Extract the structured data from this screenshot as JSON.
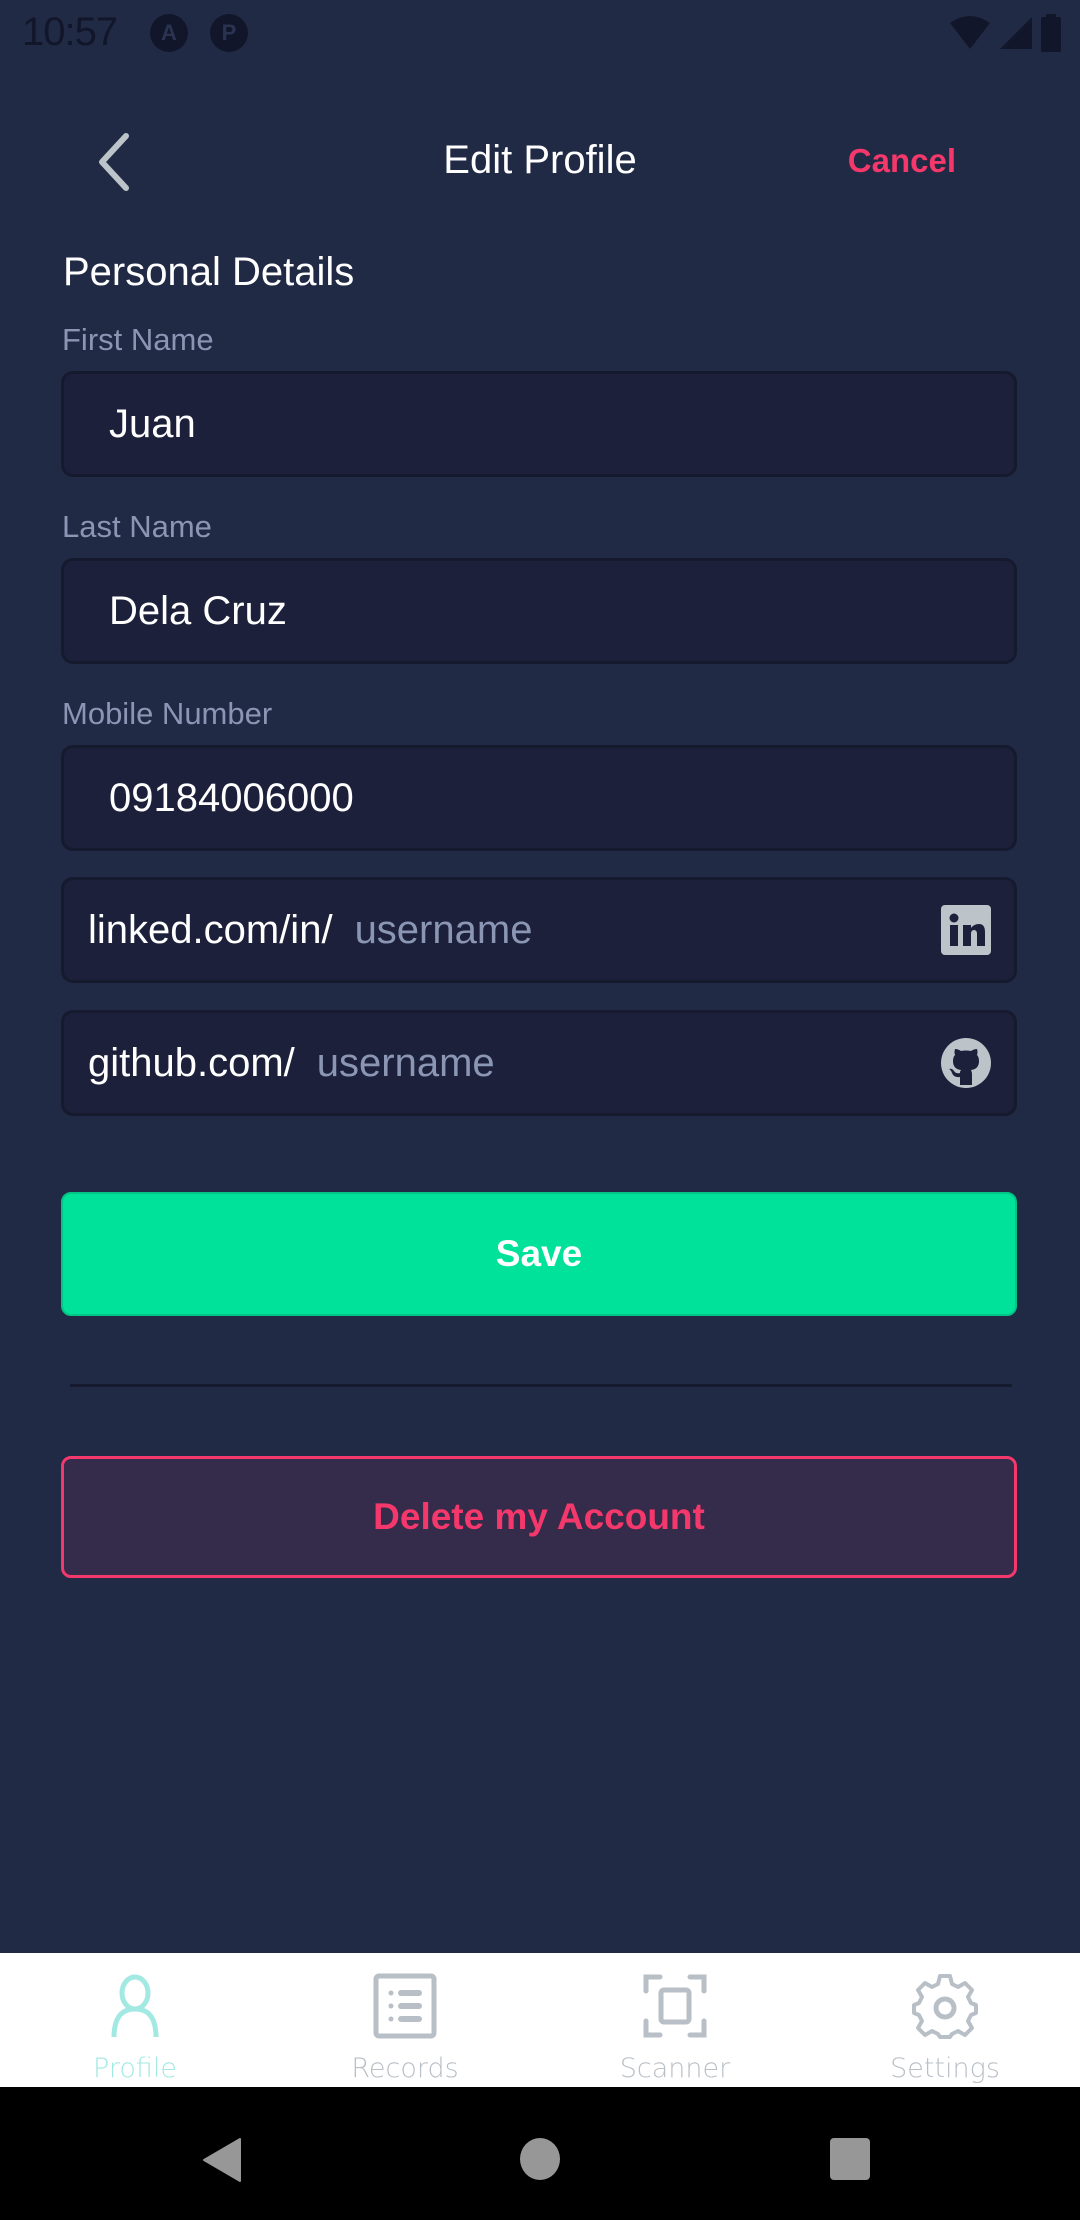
{
  "status_bar": {
    "time": "10:57",
    "app_icons": [
      "A",
      "P"
    ],
    "indicators": [
      "wifi-icon",
      "signal-icon",
      "battery-icon"
    ]
  },
  "header": {
    "back_icon": "chevron-left-icon",
    "title": "Edit Profile",
    "cancel_label": "Cancel"
  },
  "section_title": "Personal Details",
  "form": {
    "first_name": {
      "label": "First Name",
      "value": "Juan"
    },
    "last_name": {
      "label": "Last Name",
      "value": "Dela Cruz"
    },
    "mobile": {
      "label": "Mobile Number",
      "value": "09184006000"
    },
    "linkedin": {
      "prefix": "linked.com/in/",
      "placeholder": "username",
      "value": "",
      "icon": "linkedin-icon"
    },
    "github": {
      "prefix": "github.com/",
      "placeholder": "username",
      "value": "",
      "icon": "github-icon"
    }
  },
  "actions": {
    "save_label": "Save",
    "delete_label": "Delete my Account"
  },
  "tabbar": {
    "active": "Profile",
    "items": [
      {
        "label": "Profile",
        "icon": "user-icon"
      },
      {
        "label": "Records",
        "icon": "list-icon"
      },
      {
        "label": "Scanner",
        "icon": "scan-icon"
      },
      {
        "label": "Settings",
        "icon": "gear-icon"
      }
    ]
  },
  "colors": {
    "background": "#212a45",
    "input_bg": "#1c203a",
    "accent_green": "#00e19a",
    "danger": "#f5386b",
    "active_tab": "#a3e9e3",
    "inactive_tab": "#b8bfc6",
    "label": "#8a96b3"
  }
}
